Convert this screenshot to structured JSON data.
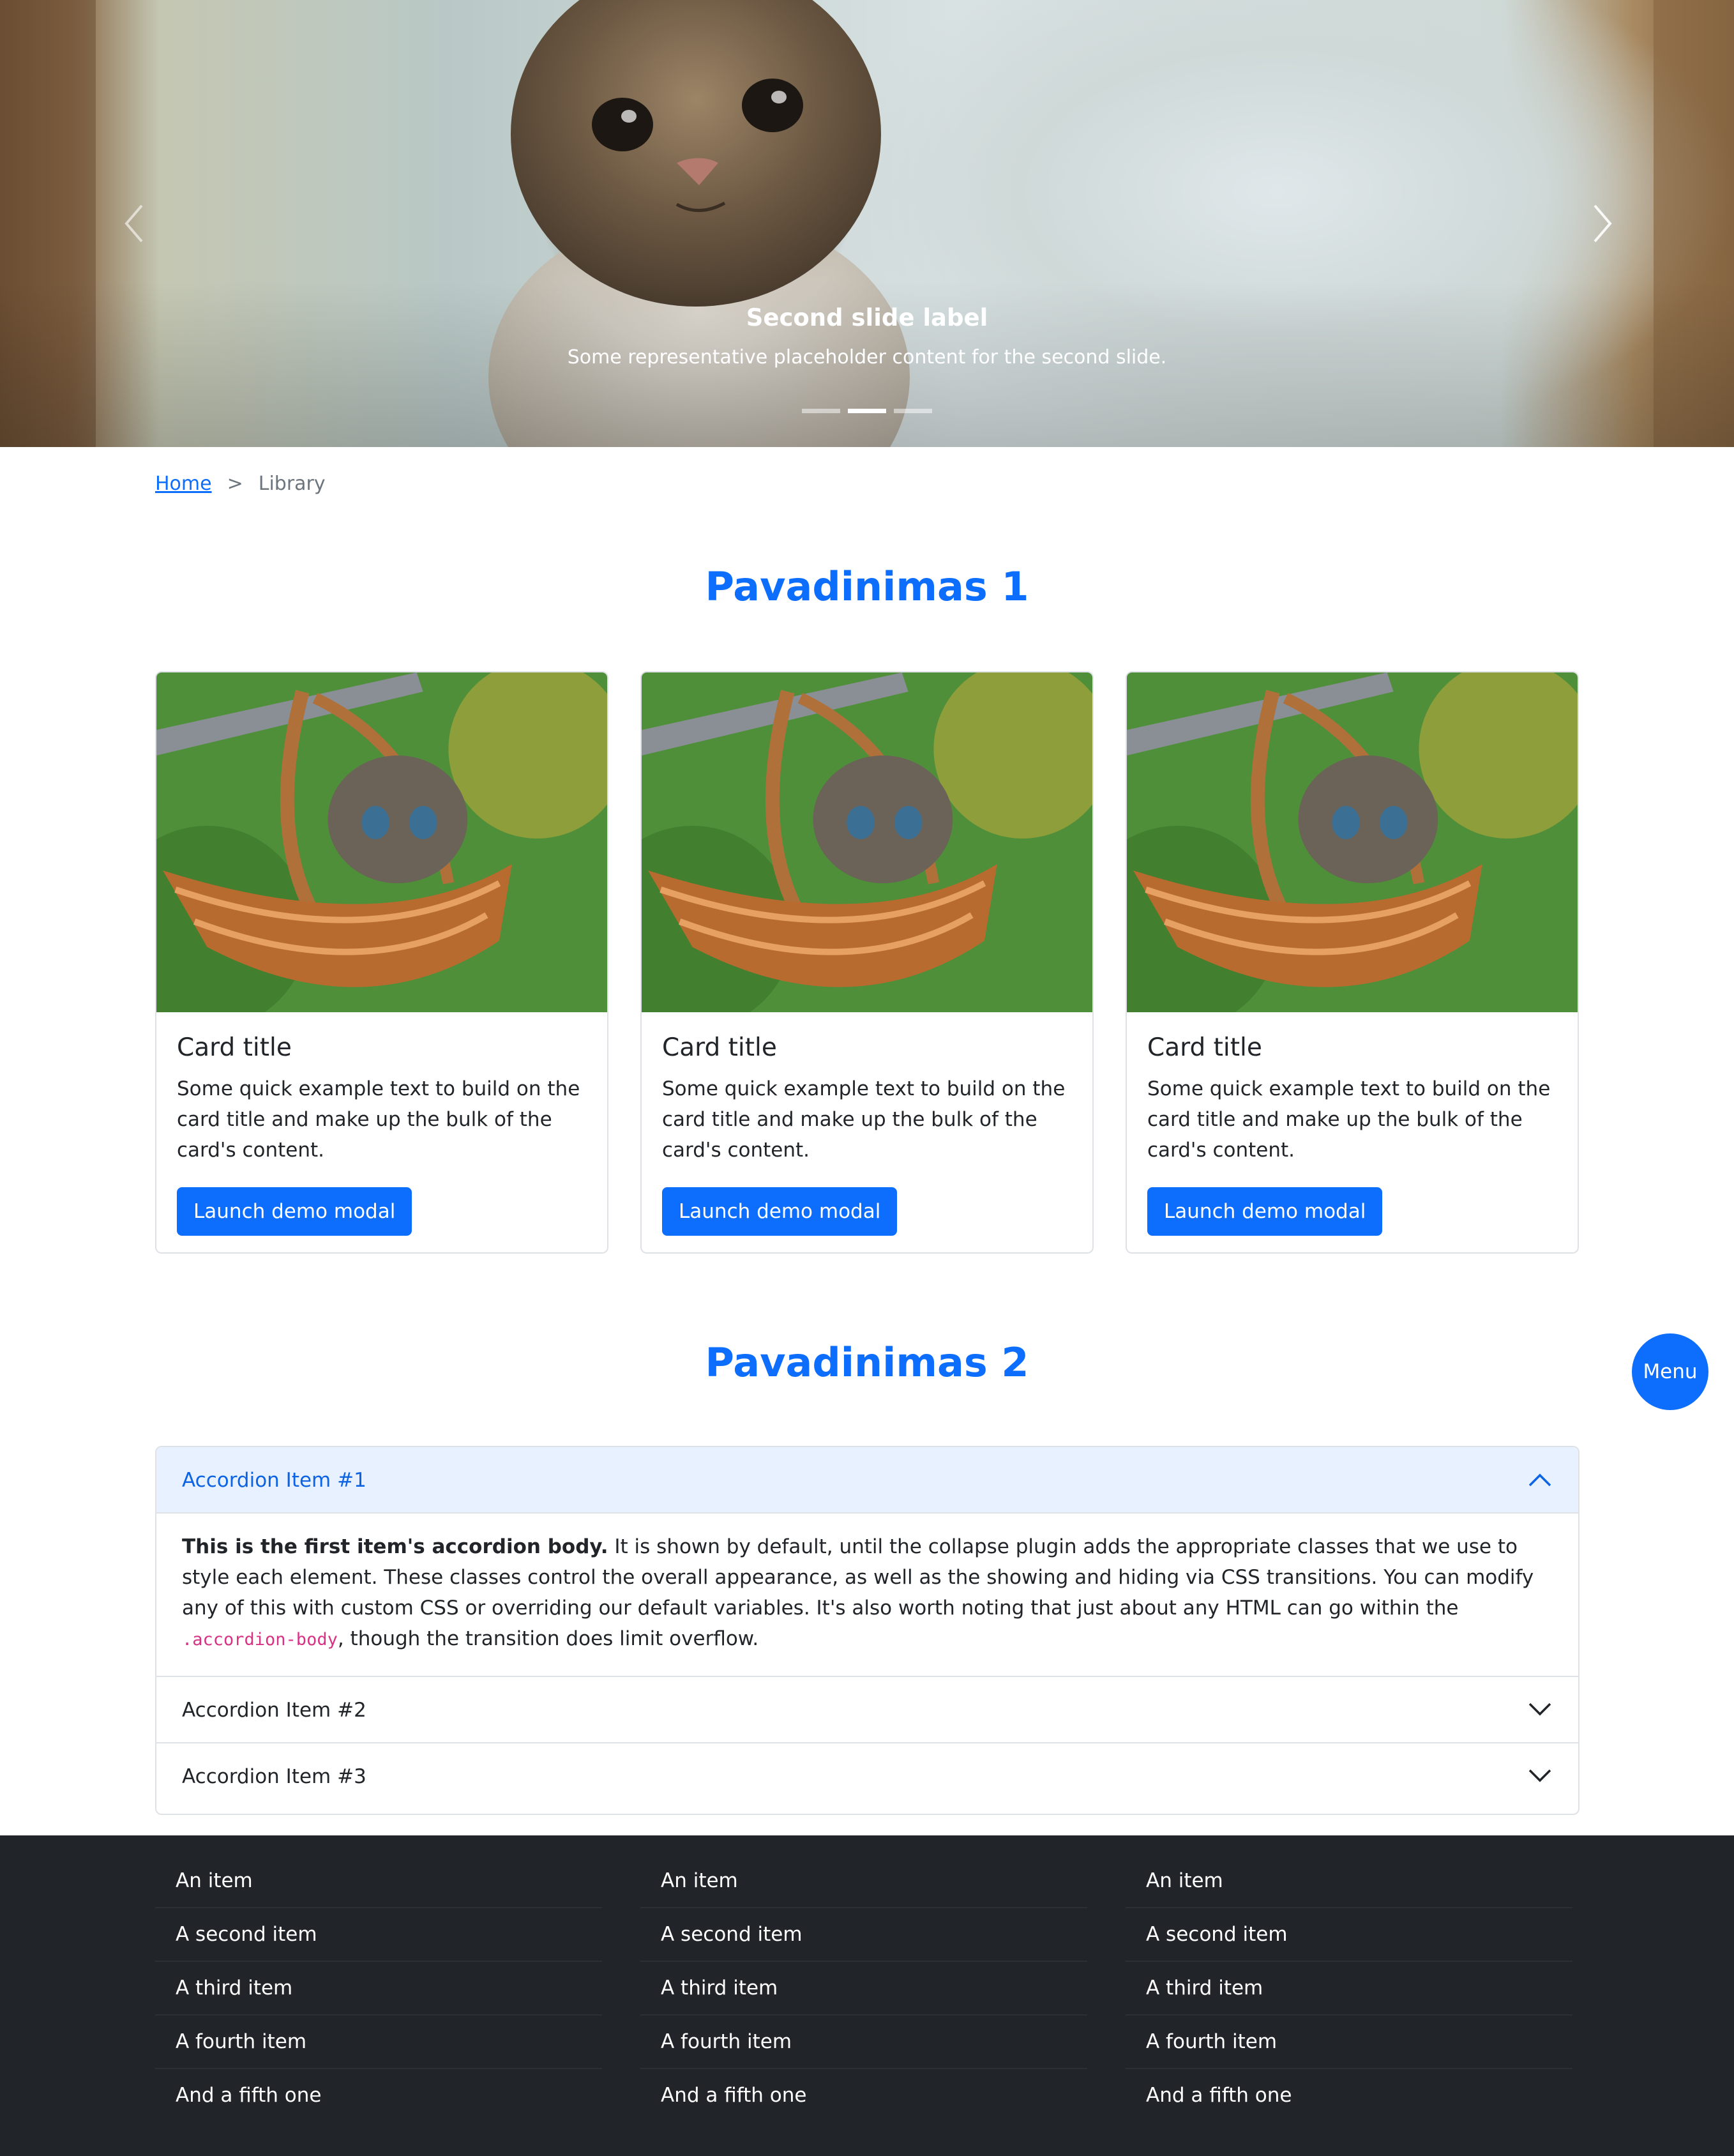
{
  "carousel": {
    "slide_title": "Second slide label",
    "slide_text": "Some representative placeholder content for the second slide.",
    "indicator_count": 3,
    "active_indicator": 2
  },
  "breadcrumb": {
    "home": "Home",
    "separator": ">",
    "current": "Library"
  },
  "section1": {
    "title": "Pavadinimas 1"
  },
  "cards": [
    {
      "title": "Card title",
      "text": "Some quick example text to build on the card title and make up the bulk of the card's content.",
      "button": "Launch demo modal"
    },
    {
      "title": "Card title",
      "text": "Some quick example text to build on the card title and make up the bulk of the card's content.",
      "button": "Launch demo modal"
    },
    {
      "title": "Card title",
      "text": "Some quick example text to build on the card title and make up the bulk of the card's content.",
      "button": "Launch demo modal"
    }
  ],
  "section2": {
    "title": "Pavadinimas 2"
  },
  "menu_button": "Menu",
  "accordion": {
    "items": [
      {
        "label": "Accordion Item #1",
        "expanded": true
      },
      {
        "label": "Accordion Item #2",
        "expanded": false
      },
      {
        "label": "Accordion Item #3",
        "expanded": false
      }
    ],
    "body_strong": "This is the first item's accordion body.",
    "body_text_1": " It is shown by default, until the collapse plugin adds the appropriate classes that we use to style each element. These classes control the overall appearance, as well as the showing and hiding via CSS transitions. You can modify any of this with custom CSS or overriding our default variables. It's also worth noting that just about any HTML can go within the ",
    "body_code": ".accordion-body",
    "body_text_2": ", though the transition does limit overflow."
  },
  "footer": {
    "columns": [
      [
        "An item",
        "A second item",
        "A third item",
        "A fourth item",
        "And a fifth one"
      ],
      [
        "An item",
        "A second item",
        "A third item",
        "A fourth item",
        "And a fifth one"
      ],
      [
        "An item",
        "A second item",
        "A third item",
        "A fourth item",
        "And a fifth one"
      ]
    ]
  },
  "colors": {
    "primary": "#0d6efd",
    "accordion_open_bg": "#e7f1ff",
    "footer_bg": "#212529",
    "code": "#d63384"
  },
  "icons": [
    "chevron-left-icon",
    "chevron-right-icon",
    "chevron-up-icon",
    "chevron-down-icon"
  ]
}
